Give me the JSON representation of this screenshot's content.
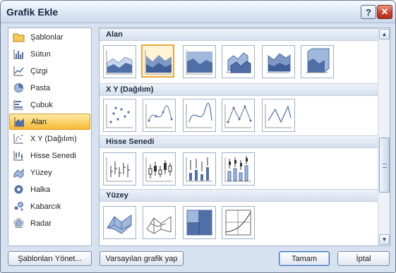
{
  "window": {
    "title": "Grafik Ekle"
  },
  "titlebar": {
    "help_label": "?",
    "close_label": "✕"
  },
  "categories": [
    {
      "label": "Şablonlar",
      "icon": "folder-icon"
    },
    {
      "label": "Sütun",
      "icon": "column-chart-icon"
    },
    {
      "label": "Çizgi",
      "icon": "line-chart-icon"
    },
    {
      "label": "Pasta",
      "icon": "pie-chart-icon"
    },
    {
      "label": "Çubuk",
      "icon": "bar-chart-icon"
    },
    {
      "label": "Alan",
      "icon": "area-chart-icon",
      "selected": true
    },
    {
      "label": "X Y (Dağılım)",
      "icon": "scatter-chart-icon"
    },
    {
      "label": "Hisse Senedi",
      "icon": "stock-chart-icon"
    },
    {
      "label": "Yüzey",
      "icon": "surface-chart-icon"
    },
    {
      "label": "Halka",
      "icon": "doughnut-chart-icon"
    },
    {
      "label": "Kabarcık",
      "icon": "bubble-chart-icon"
    },
    {
      "label": "Radar",
      "icon": "radar-chart-icon"
    }
  ],
  "sections": [
    {
      "title": "Alan",
      "thumb_count": 6,
      "selected_index": 1
    },
    {
      "title": "X Y (Dağılım)",
      "thumb_count": 5
    },
    {
      "title": "Hisse Senedi",
      "thumb_count": 4
    },
    {
      "title": "Yüzey",
      "thumb_count": 4
    }
  ],
  "scrollbar": {
    "up_arrow": "▲",
    "down_arrow": "▼"
  },
  "footer": {
    "manage_templates_label": "Şablonları Yönet...",
    "set_default_label": "Varsayılan grafik yap",
    "ok_label": "Tamam",
    "cancel_label": "İptal"
  },
  "colors": {
    "selection": "#f8c453",
    "chart_blue": "#4f6fa6",
    "chart_light": "#9fb8dc"
  }
}
